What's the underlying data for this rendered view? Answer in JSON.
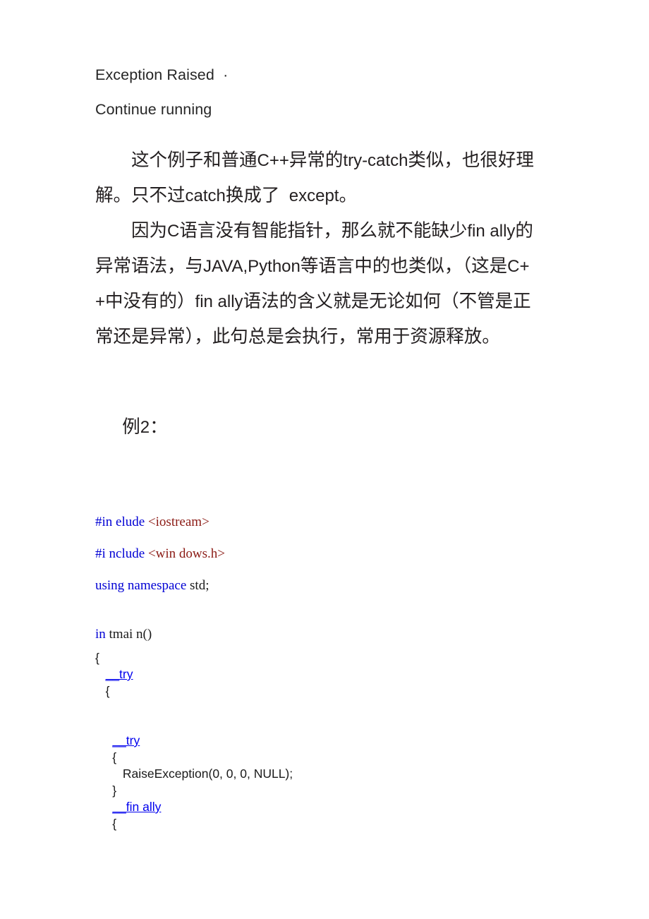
{
  "document": {
    "console_output": {
      "line1": "Exception Raised  ·",
      "line2": "Continue running"
    },
    "paragraphs": [
      {
        "id": "para-try-catch",
        "segments": [
          {
            "text": "　　这个例子和普通",
            "style": "cjk"
          },
          {
            "text": "C++",
            "style": "latin"
          },
          {
            "text": "异常的",
            "style": "cjk"
          },
          {
            "text": "try-catch",
            "style": "latin"
          },
          {
            "text": "类似，也很好理解。只不过",
            "style": "cjk"
          },
          {
            "text": "catch",
            "style": "latin"
          },
          {
            "text": "换成了",
            "style": "cjk"
          },
          {
            "text": "  except",
            "style": "latin"
          },
          {
            "text": "。",
            "style": "cjk"
          }
        ]
      },
      {
        "id": "para-finally",
        "segments": [
          {
            "text": "　　因为",
            "style": "cjk"
          },
          {
            "text": "C",
            "style": "latin"
          },
          {
            "text": "语言没有智能指针，那么就不能缺少",
            "style": "cjk"
          },
          {
            "text": "fin ally",
            "style": "latin"
          },
          {
            "text": "的异常语法，与",
            "style": "cjk"
          },
          {
            "text": "JAVA,Python",
            "style": "latin"
          },
          {
            "text": "等语言中的也类似，（这是",
            "style": "cjk"
          },
          {
            "text": "C++",
            "style": "latin"
          },
          {
            "text": "中没有的）",
            "style": "cjk"
          },
          {
            "text": "fin ally",
            "style": "latin"
          },
          {
            "text": "语法的含义就是无论如何（不管是正常还是异常），此句总是会执行，常用于资源释放。",
            "style": "cjk"
          }
        ]
      }
    ],
    "example_label": {
      "prefix": "例",
      "number": "2",
      "suffix": "："
    },
    "code": {
      "lines": [
        {
          "id": "include-iostream",
          "spacing": "loose",
          "font": "serif",
          "tokens": [
            {
              "t": "#in elude ",
              "c": "keyword"
            },
            {
              "t": "<iostream>",
              "c": "include"
            }
          ]
        },
        {
          "id": "include-windows",
          "spacing": "loose",
          "font": "serif",
          "tokens": [
            {
              "t": "#i nclude ",
              "c": "keyword"
            },
            {
              "t": "<win dows.h>",
              "c": "include"
            }
          ]
        },
        {
          "id": "using-namespace",
          "spacing": "loose",
          "font": "serif",
          "tokens": [
            {
              "t": "using namespace ",
              "c": "keyword"
            },
            {
              "t": "std;",
              "c": "plain"
            }
          ]
        },
        {
          "id": "blank-1",
          "spacing": "blank",
          "font": "serif",
          "tokens": [
            {
              "t": " ",
              "c": "plain"
            }
          ]
        },
        {
          "id": "main-signature",
          "spacing": "loose",
          "font": "serif",
          "tokens": [
            {
              "t": "in ",
              "c": "keyword"
            },
            {
              "t": "tmai n()",
              "c": "plain"
            }
          ]
        },
        {
          "id": "main-open-brace",
          "spacing": "tight",
          "font": "sans",
          "tokens": [
            {
              "t": "{",
              "c": "plain"
            }
          ]
        },
        {
          "id": "outer-try",
          "spacing": "tight",
          "font": "sans",
          "tokens": [
            {
              "t": "   ",
              "c": "plain"
            },
            {
              "t": "__try",
              "c": "keyword-underline"
            }
          ]
        },
        {
          "id": "outer-try-open-brace",
          "spacing": "tight",
          "font": "sans",
          "tokens": [
            {
              "t": "   {",
              "c": "plain"
            }
          ]
        },
        {
          "id": "blank-2",
          "spacing": "tight",
          "font": "sans",
          "tokens": [
            {
              "t": " ",
              "c": "plain"
            }
          ]
        },
        {
          "id": "blank-3",
          "spacing": "tight",
          "font": "sans",
          "tokens": [
            {
              "t": " ",
              "c": "plain"
            }
          ]
        },
        {
          "id": "inner-try",
          "spacing": "tight",
          "font": "sans",
          "tokens": [
            {
              "t": "     ",
              "c": "plain"
            },
            {
              "t": "__try",
              "c": "keyword-underline"
            }
          ]
        },
        {
          "id": "inner-try-open-brace",
          "spacing": "tight",
          "font": "sans",
          "tokens": [
            {
              "t": "     {",
              "c": "plain"
            }
          ]
        },
        {
          "id": "raise-exception-call",
          "spacing": "tight",
          "font": "sans",
          "tokens": [
            {
              "t": "        RaiseException(0, 0, 0, NULL);",
              "c": "plain"
            }
          ]
        },
        {
          "id": "inner-try-close-brace",
          "spacing": "tight",
          "font": "sans",
          "tokens": [
            {
              "t": "     }",
              "c": "plain"
            }
          ]
        },
        {
          "id": "inner-finally",
          "spacing": "tight",
          "font": "sans",
          "tokens": [
            {
              "t": "     ",
              "c": "plain"
            },
            {
              "t": "__fin ally",
              "c": "keyword-underline"
            }
          ]
        },
        {
          "id": "inner-finally-open-brace",
          "spacing": "tight",
          "font": "sans",
          "tokens": [
            {
              "t": "     {",
              "c": "plain"
            }
          ]
        }
      ]
    }
  },
  "colors": {
    "keyword": "#0000d4",
    "keyword_underline": "#0000ee",
    "include": "#8b1a14",
    "plain": "#1a1a1a",
    "body_text": "#231f20",
    "console_text": "#262626",
    "page_background": "#ffffff"
  }
}
